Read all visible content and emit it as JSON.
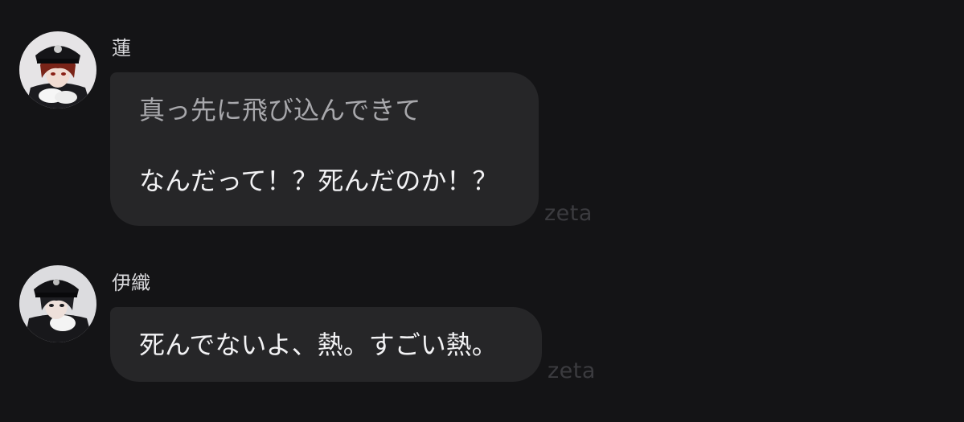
{
  "conversation": {
    "messages": [
      {
        "sender": "蓮",
        "avatar_icon": "character-portrait-officer-cap-red-hair",
        "narration": "真っ先に飛び込んできて",
        "dialogue": "なんだって！？死んだのか！？",
        "watermark": "zeta"
      },
      {
        "sender": "伊織",
        "avatar_icon": "character-portrait-officer-cap-dark-hair",
        "dialogue": "死んでないよ、熱。すごい熱。",
        "watermark": "zeta"
      }
    ]
  },
  "colors": {
    "background": "#141416",
    "bubble": "#262628",
    "dialogue_text": "#f2f2f4",
    "narration_text": "#a8a8ac",
    "watermark": "#3b3b3f"
  }
}
